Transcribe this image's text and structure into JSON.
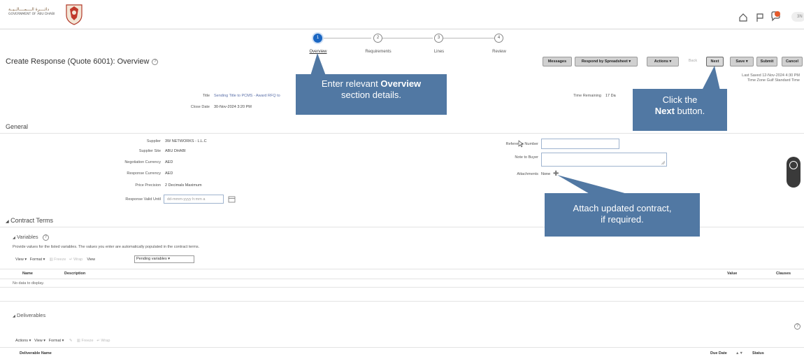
{
  "header": {
    "logo_text_ar": "دائــــرة الــــمــــالــيــة",
    "logo_text_en": "GOVERNMENT OF ABU DHABI",
    "user_initials": "3N"
  },
  "train": {
    "steps": [
      {
        "num": "1",
        "label": "Overview"
      },
      {
        "num": "2",
        "label": "Requirements"
      },
      {
        "num": "3",
        "label": "Lines"
      },
      {
        "num": "4",
        "label": "Review"
      }
    ]
  },
  "page": {
    "title": "Create Response (Quote 6001): Overview",
    "help": "?"
  },
  "toolbar": {
    "messages": "Messages",
    "respond_spreadsheet": "Respond by Spreadsheet",
    "actions": "Actions",
    "back": "Back",
    "next": "Next",
    "save": "Save",
    "submit": "Submit",
    "cancel": "Cancel",
    "last_saved": "Last Saved 12-Nov-2024 4:30 PM",
    "time_zone": "Time Zone Gulf Standard Time"
  },
  "summary": {
    "title_label": "Title",
    "title_value": "Sending Title to PCMS - Award RFQ to",
    "close_date_label": "Close Date",
    "close_date_value": "30-Nov-2024 3:20 PM",
    "time_remaining_label": "Time Remaining",
    "time_remaining_value": "17 Da"
  },
  "general": {
    "heading": "General",
    "fields": [
      {
        "label": "Supplier",
        "value": "3W NETWORKS - L.L.C"
      },
      {
        "label": "Supplier Site",
        "value": "ABU DHABI"
      },
      {
        "label": "Negotiation Currency",
        "value": "AED"
      },
      {
        "label": "Response Currency",
        "value": "AED"
      },
      {
        "label": "Price Precision",
        "value": "2 Decimals Maximum"
      }
    ],
    "valid_until_label": "Response Valid Until",
    "valid_until_placeholder": "dd-mmm-yyyy h:mm a",
    "reference_number_label": "Reference Number",
    "note_to_buyer_label": "Note to Buyer",
    "attachments_label": "Attachments",
    "attachments_value": "None"
  },
  "contract": {
    "heading": "Contract Terms",
    "variables_heading": "Variables",
    "variables_hint": "Provide values for the listed variables. The values you enter are automatically populated in the contract terms.",
    "view": "View",
    "format": "Format",
    "freeze": "Freeze",
    "wrap": "Wrap",
    "view_label": "View",
    "view_select": "Pending variables",
    "columns": {
      "name": "Name",
      "description": "Description",
      "value": "Value",
      "clauses": "Clauses"
    },
    "no_data": "No data to display."
  },
  "deliverables": {
    "heading": "Deliverables",
    "actions": "Actions",
    "view": "View",
    "format": "Format",
    "freeze": "Freeze",
    "wrap": "Wrap",
    "columns": {
      "name": "Deliverable Name",
      "due_date": "Due Date",
      "status": "Status"
    }
  },
  "callouts": {
    "overview_pre": "Enter relevant ",
    "overview_bold": "Overview",
    "overview_post": "section details.",
    "next_pre": "Click the",
    "next_bold": "Next",
    "next_post": " button.",
    "attach_line1": "Attach updated contract,",
    "attach_line2": "if required."
  },
  "colors": {
    "callout": "#5178a3",
    "train_active": "#1a66c2"
  }
}
